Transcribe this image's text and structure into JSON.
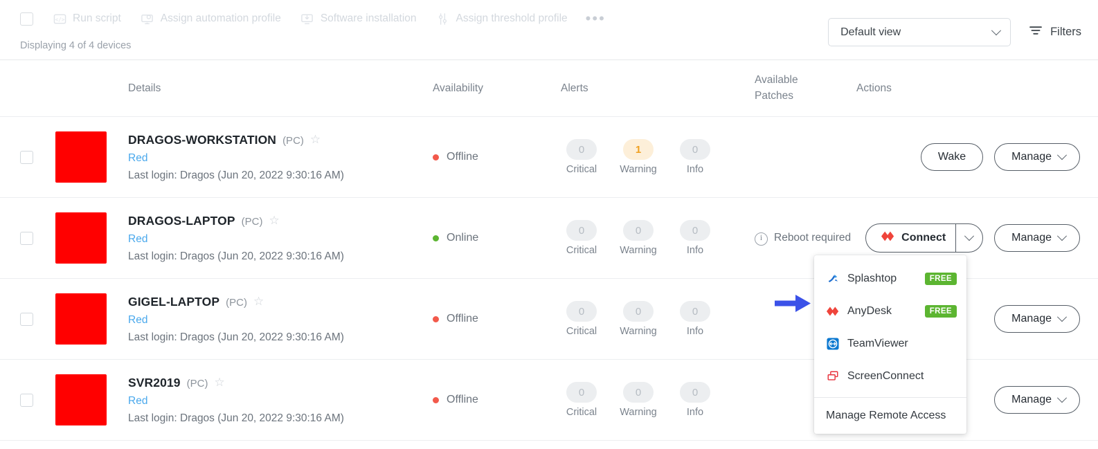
{
  "toolbar": {
    "select_all_checkbox": "",
    "actions": [
      {
        "label": "Run script",
        "icon": "code-script-icon",
        "disabled": true
      },
      {
        "label": "Assign automation profile",
        "icon": "monitor-gear-icon",
        "disabled": true
      },
      {
        "label": "Software installation",
        "icon": "monitor-download-icon",
        "disabled": true
      },
      {
        "label": "Assign threshold profile",
        "icon": "sliders-icon",
        "disabled": true
      }
    ],
    "more_label": "•••",
    "displaying_text": "Displaying 4 of 4 devices",
    "view_select_value": "Default view",
    "filters_label": "Filters"
  },
  "table": {
    "headers": {
      "details": "Details",
      "availability": "Availability",
      "alerts": "Alerts",
      "available_patches": "Available Patches",
      "available_patches_line1": "Available",
      "available_patches_line2": "Patches",
      "actions": "Actions"
    },
    "alert_labels": {
      "critical": "Critical",
      "warning": "Warning",
      "info": "Info"
    },
    "rows": [
      {
        "name": "DRAGOS-WORKSTATION",
        "type": "(PC)",
        "tag": "Red",
        "last_login": "Last login: Dragos (Jun 20, 2022 9:30:16 AM)",
        "availability": "Offline",
        "availability_color": "#f2594b",
        "alerts": {
          "critical": "0",
          "warning": "1",
          "info": "0"
        },
        "warning_active": true,
        "patches": "",
        "buttons": {
          "wake": "Wake",
          "manage": "Manage"
        },
        "has_wake": true,
        "has_connect": false
      },
      {
        "name": "DRAGOS-LAPTOP",
        "type": "(PC)",
        "tag": "Red",
        "last_login": "Last login: Dragos (Jun 20, 2022 9:30:16 AM)",
        "availability": "Online",
        "availability_color": "#5cb531",
        "alerts": {
          "critical": "0",
          "warning": "0",
          "info": "0"
        },
        "warning_active": false,
        "patches": "Reboot required",
        "buttons": {
          "connect": "Connect",
          "manage": "Manage"
        },
        "has_wake": false,
        "has_connect": true
      },
      {
        "name": "GIGEL-LAPTOP",
        "type": "(PC)",
        "tag": "Red",
        "last_login": "Last login: Dragos (Jun 20, 2022 9:30:16 AM)",
        "availability": "Offline",
        "availability_color": "#f2594b",
        "alerts": {
          "critical": "0",
          "warning": "0",
          "info": "0"
        },
        "warning_active": false,
        "patches": "",
        "buttons": {
          "manage": "Manage"
        },
        "has_wake": false,
        "has_connect": false
      },
      {
        "name": "SVR2019",
        "type": "(PC)",
        "tag": "Red",
        "last_login": "Last login: Dragos (Jun 20, 2022 9:30:16 AM)",
        "availability": "Offline",
        "availability_color": "#f2594b",
        "alerts": {
          "critical": "0",
          "warning": "0",
          "info": "0"
        },
        "warning_active": false,
        "patches": "",
        "buttons": {
          "manage": "Manage"
        },
        "has_wake": false,
        "has_connect": false
      }
    ]
  },
  "connect_menu": {
    "items": [
      {
        "label": "Splashtop",
        "icon": "splashtop-icon",
        "badge": "FREE"
      },
      {
        "label": "AnyDesk",
        "icon": "anydesk-icon",
        "badge": "FREE"
      },
      {
        "label": "TeamViewer",
        "icon": "teamviewer-icon",
        "badge": ""
      },
      {
        "label": "ScreenConnect",
        "icon": "screenconnect-icon",
        "badge": ""
      }
    ],
    "footer_label": "Manage Remote Access"
  },
  "annotation": {
    "arrow_color": "#3b52e8"
  },
  "colors": {
    "accent_blue": "#49a8ec",
    "offline_red": "#f2594b",
    "online_green": "#5cb531",
    "warning_amber": "#f0a020",
    "thumb_red": "#ff0000",
    "free_badge_green": "#5cb531"
  }
}
